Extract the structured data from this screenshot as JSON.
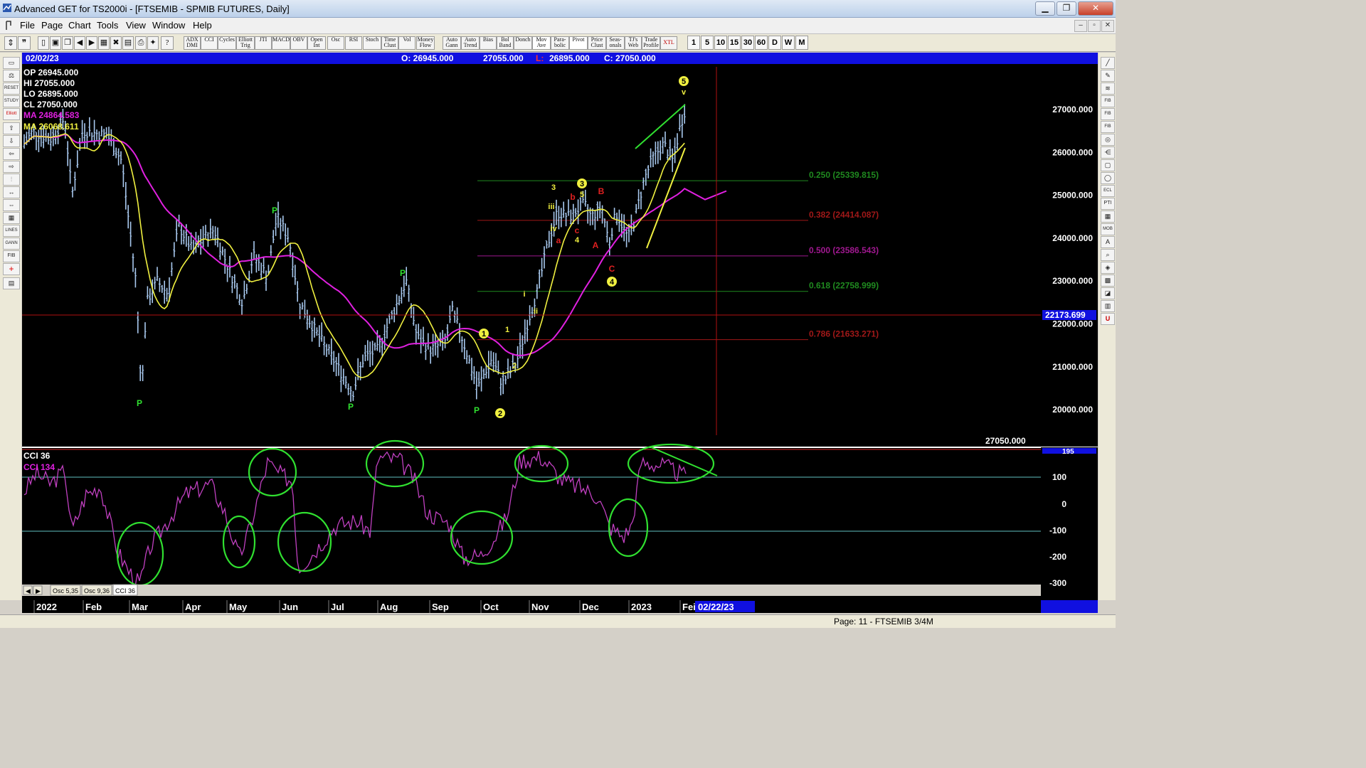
{
  "window": {
    "title": "Advanced GET for TS2000i - [FTSEMIB - SPMIB FUTURES, Daily]",
    "minimize_label": "▁",
    "restore_label": "❐",
    "close_label": "✕"
  },
  "menu": [
    "File",
    "Page",
    "Chart",
    "Tools",
    "View",
    "Window",
    "Help"
  ],
  "toolbar": {
    "study_buttons": [
      "ADX DMI",
      "CCI",
      "Cycles",
      "Elliott Trig",
      "JTI",
      "MACD",
      "OBV",
      "Open Int",
      "Osc",
      "RSI",
      "Stoch",
      "Time Clust",
      "Vol",
      "Money Flow",
      "Auto Gann",
      "Auto Trend",
      "Bias",
      "Bol Band",
      "Donch",
      "Mov Ave",
      "Para-bolic",
      "Pivot",
      "Price Clust",
      "Seas-onals",
      "TJ's Web",
      "Trade Profile",
      "XTL"
    ],
    "timeframes": [
      "1",
      "5",
      "10",
      "15",
      "30",
      "60",
      "D",
      "W",
      "M"
    ]
  },
  "header": {
    "date": "02/02/23",
    "open": "O: 26945.000",
    "high": "27055.000",
    "low_label": "L:",
    "low": "26895.000",
    "close": "C: 27050.000"
  },
  "legend": {
    "op": "OP  26945.000",
    "hi": "HI   27055.000",
    "lo": "LO  26895.000",
    "cl": "CL  27050.000",
    "ma1": "MA  24864.583",
    "ma2": "MA  26068.611"
  },
  "colors": {
    "background": "#000000",
    "bars": "#a8c8ee",
    "ma_slow": "#e020e0",
    "ma_fast": "#f0f040",
    "green": "#30e030",
    "red": "#e02020",
    "cci": "#c040c0"
  },
  "price_axis": {
    "ticks": [
      "27000.000",
      "26000.000",
      "25000.000",
      "24000.000",
      "23000.000",
      "22000.000",
      "21000.000",
      "20000.000"
    ],
    "cursor_price": "22173.699",
    "last_price": "27050.000"
  },
  "fib_levels": [
    {
      "label": "0.250 (25339.815)",
      "value": 25339.815,
      "color": "#1f8a1f"
    },
    {
      "label": "0.382 (24414.087)",
      "value": 24414.087,
      "color": "#a01818"
    },
    {
      "label": "0.500 (23586.543)",
      "value": 23586.543,
      "color": "#a01890"
    },
    {
      "label": "0.618 (22758.999)",
      "value": 22758.999,
      "color": "#1f8a1f"
    },
    {
      "label": "0.786 (21633.271)",
      "value": 21633.271,
      "color": "#a01818"
    }
  ],
  "cci_panel": {
    "title": "CCI 36",
    "value_label": "CCI  134",
    "ticks": [
      "100",
      "0",
      "-100",
      "-200",
      "-300"
    ],
    "top_value": "195",
    "tabs": [
      "Osc 5,35",
      "Osc 9,36",
      "CCI 36"
    ]
  },
  "date_axis": {
    "labels": [
      "2022",
      "Feb",
      "Mar",
      "Apr",
      "May",
      "Jun",
      "Jul",
      "Aug",
      "Sep",
      "Oct",
      "Nov",
      "Dec",
      "2023",
      "Fei"
    ],
    "cursor_date": "02/22/23"
  },
  "wave_labels": {
    "pivots": [
      "P",
      "P",
      "P",
      "P",
      "P",
      "P"
    ],
    "primary": [
      "1",
      "2",
      "3",
      "4",
      "5"
    ],
    "minor_yellow": [
      "1",
      "2",
      "3",
      "4",
      "5",
      "i",
      "ii",
      "iii",
      "iv",
      "v"
    ],
    "abc": [
      "a",
      "b",
      "c",
      "A",
      "B",
      "C"
    ]
  },
  "status": "Page: 11 - FTSEMIB 3/4M"
}
